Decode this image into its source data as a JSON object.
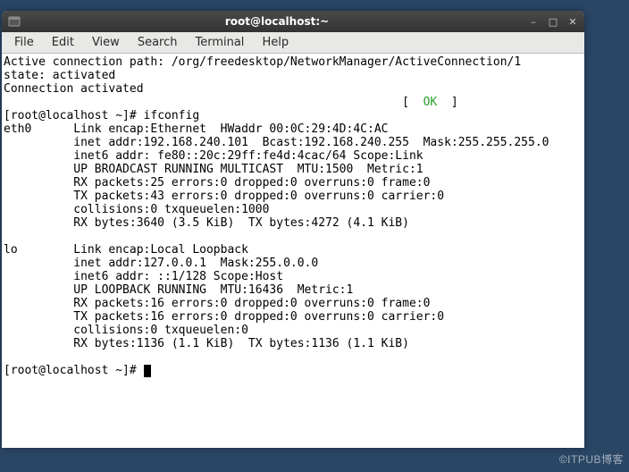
{
  "window": {
    "title": "root@localhost:~"
  },
  "menubar": {
    "file": "File",
    "edit": "Edit",
    "view": "View",
    "search": "Search",
    "terminal": "Terminal",
    "help": "Help"
  },
  "terminal": {
    "line1": "Active connection path: /org/freedesktop/NetworkManager/ActiveConnection/1",
    "line2": "state: activated",
    "line3": "Connection activated",
    "ok_open": "[  ",
    "ok_text": "OK",
    "ok_close": "  ]",
    "prompt1": "[root@localhost ~]# ",
    "cmd1": "ifconfig",
    "eth_hdr": "eth0      Link encap:Ethernet  HWaddr 00:0C:29:4D:4C:AC",
    "eth_l2": "          inet addr:192.168.240.101  Bcast:192.168.240.255  Mask:255.255.255.0",
    "eth_l3": "          inet6 addr: fe80::20c:29ff:fe4d:4cac/64 Scope:Link",
    "eth_l4": "          UP BROADCAST RUNNING MULTICAST  MTU:1500  Metric:1",
    "eth_l5": "          RX packets:25 errors:0 dropped:0 overruns:0 frame:0",
    "eth_l6": "          TX packets:43 errors:0 dropped:0 overruns:0 carrier:0",
    "eth_l7": "          collisions:0 txqueuelen:1000",
    "eth_l8": "          RX bytes:3640 (3.5 KiB)  TX bytes:4272 (4.1 KiB)",
    "blank": "",
    "lo_hdr": "lo        Link encap:Local Loopback",
    "lo_l2": "          inet addr:127.0.0.1  Mask:255.0.0.0",
    "lo_l3": "          inet6 addr: ::1/128 Scope:Host",
    "lo_l4": "          UP LOOPBACK RUNNING  MTU:16436  Metric:1",
    "lo_l5": "          RX packets:16 errors:0 dropped:0 overruns:0 frame:0",
    "lo_l6": "          TX packets:16 errors:0 dropped:0 overruns:0 carrier:0",
    "lo_l7": "          collisions:0 txqueuelen:0",
    "lo_l8": "          RX bytes:1136 (1.1 KiB)  TX bytes:1136 (1.1 KiB)",
    "prompt2": "[root@localhost ~]# "
  },
  "watermark": "©ITPUB博客"
}
